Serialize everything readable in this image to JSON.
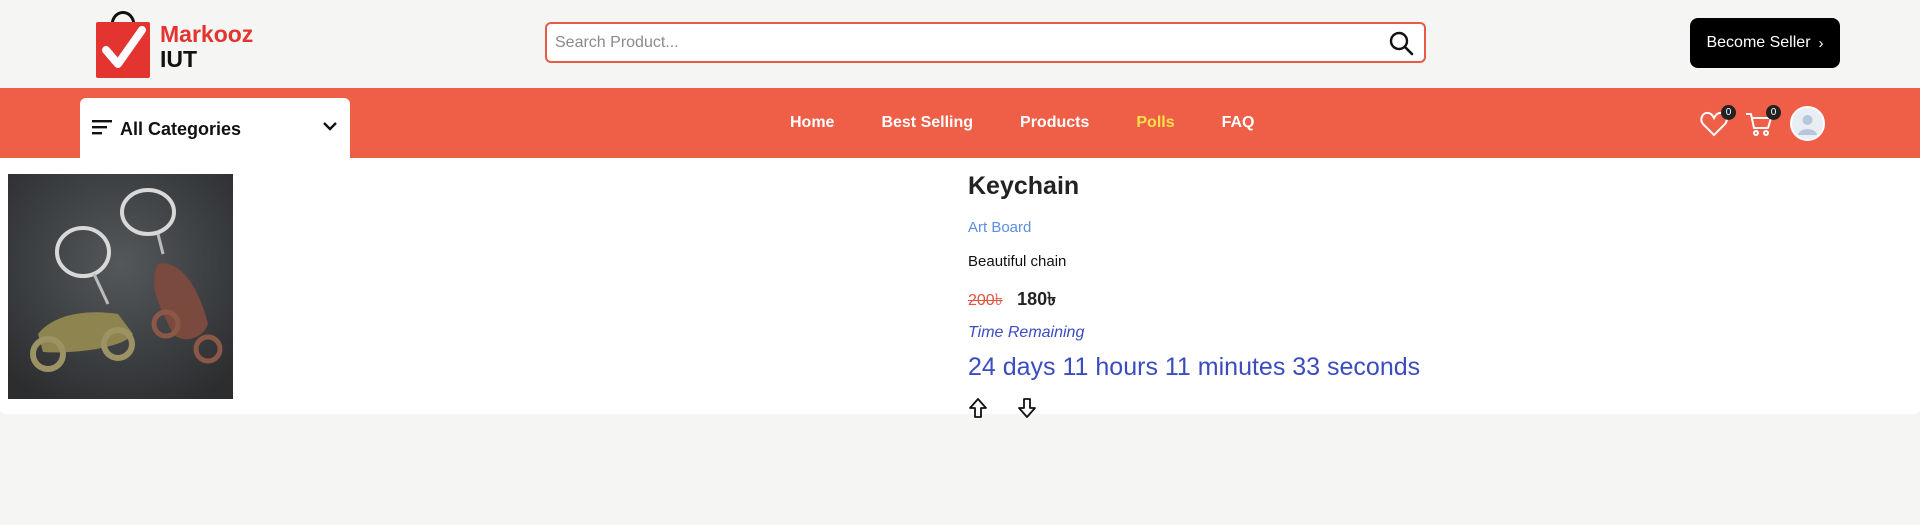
{
  "brand": {
    "line1": "Markooz",
    "line2": "IUT",
    "logo_icon": "shopping-bag-check-icon"
  },
  "search": {
    "placeholder": "Search Product...",
    "value": "",
    "icon": "search-icon"
  },
  "header": {
    "seller_button": "Become Seller",
    "seller_icon": "chevron-right-icon"
  },
  "navbar": {
    "categories_label": "All Categories",
    "links": [
      {
        "label": "Home",
        "active": false
      },
      {
        "label": "Best Selling",
        "active": false
      },
      {
        "label": "Products",
        "active": false
      },
      {
        "label": "Polls",
        "active": true
      },
      {
        "label": "FAQ",
        "active": false
      }
    ],
    "wishlist_count": "0",
    "cart_count": "0"
  },
  "product": {
    "title": "Keychain",
    "category": "Art Board",
    "description": "Beautiful chain",
    "old_price": "200৳",
    "price": "180৳",
    "time_label": "Time Remaining",
    "countdown": "24 days 11 hours 11 minutes 33 seconds"
  },
  "colors": {
    "accent": "#ef5e47",
    "active_link": "#f7e04a",
    "countdown": "#3b4cc0",
    "category_link": "#5b8fe0"
  }
}
